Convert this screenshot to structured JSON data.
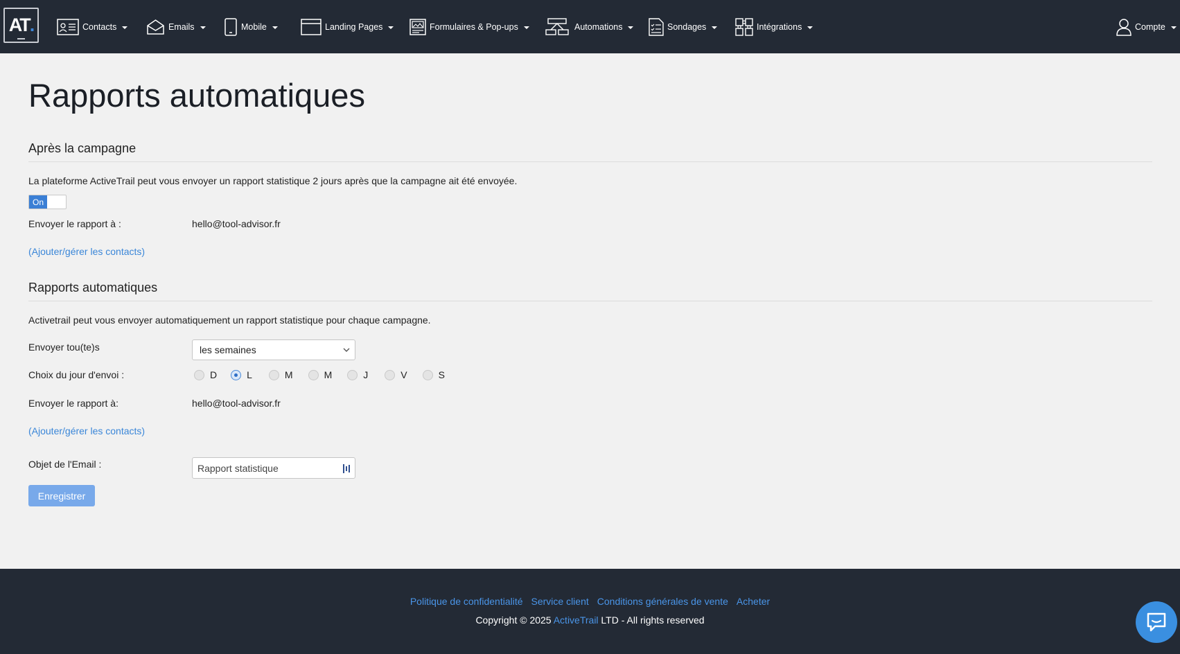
{
  "nav": {
    "logo_text": "AT",
    "logo_dot": ".",
    "items": [
      {
        "label": "Contacts",
        "icon": "contacts-card-icon"
      },
      {
        "label": "Emails",
        "icon": "envelope-icon"
      },
      {
        "label": "Mobile",
        "icon": "smartphone-icon"
      },
      {
        "label": "Landing Pages",
        "icon": "browser-window-icon"
      },
      {
        "label": "Formulaires & Pop-ups",
        "icon": "form-image-icon"
      },
      {
        "label": "Automations",
        "icon": "workflow-icon"
      },
      {
        "label": "Sondages",
        "icon": "survey-checklist-icon"
      },
      {
        "label": "Intégrations",
        "icon": "puzzle-integrations-icon"
      }
    ],
    "account": {
      "label": "Compte",
      "icon": "user-icon"
    }
  },
  "page": {
    "title": "Rapports automatiques"
  },
  "after_campaign": {
    "title": "Après la campagne",
    "description": "La plateforme ActiveTrail peut vous envoyer un rapport statistique 2 jours après que la campagne ait été envoyée.",
    "toggle_label": "On",
    "send_to_label": "Envoyer le rapport à :",
    "send_to_value": "hello@tool-advisor.fr",
    "manage_link": "(Ajouter/gérer les contacts)"
  },
  "auto_reports": {
    "title": "Rapports automatiques",
    "description": "Activetrail peut vous envoyer automatiquement un rapport statistique pour chaque campagne.",
    "frequency_label": "Envoyer tou(te)s",
    "frequency_value": "les semaines",
    "day_label": "Choix du jour d'envoi :",
    "days": [
      {
        "label": "D",
        "checked": false
      },
      {
        "label": "L",
        "checked": true
      },
      {
        "label": "M",
        "checked": false
      },
      {
        "label": "M",
        "checked": false
      },
      {
        "label": "J",
        "checked": false
      },
      {
        "label": "V",
        "checked": false
      },
      {
        "label": "S",
        "checked": false
      }
    ],
    "send_to_label": "Envoyer le rapport à:",
    "send_to_value": "hello@tool-advisor.fr",
    "manage_link": "(Ajouter/gérer les contacts)",
    "subject_label": "Objet de l'Email :",
    "subject_value": "Rapport statistique",
    "save_button": "Enregistrer"
  },
  "footer": {
    "links": [
      "Politique de confidentialité",
      "Service client",
      "Conditions générales de vente",
      "Acheter"
    ],
    "copyright_prefix": "Copyright © 2025 ",
    "brand": "ActiveTrail",
    "copyright_suffix": " LTD - All rights reserved"
  },
  "colors": {
    "nav_bg": "#232a35",
    "page_bg": "#f1f1f1",
    "link": "#3a86d8",
    "button": "#78a9ea",
    "chat_button": "#3a8fe0"
  }
}
